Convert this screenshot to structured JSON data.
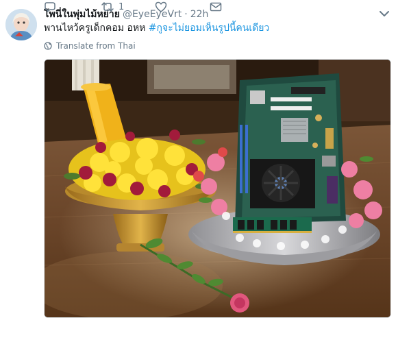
{
  "tweet": {
    "display_name": "โพนี่ในพุ่มไม้หย่าย",
    "handle": "@EyeEyeVrt",
    "separator": "·",
    "timestamp": "22h",
    "text_plain": "พานไหว้ครูเด็กคอม อหห ",
    "text_hashtag": "#กูจะไม่ยอมเห็นรูปนี้คนเดียว",
    "translate_label": "Translate from Thai",
    "retweet_count": "1",
    "media_alt": ""
  },
  "colors": {
    "link": "#1b95e0",
    "secondary_text": "#657786",
    "primary_text": "#14171a"
  },
  "icons": {
    "caret": "chevron-down-icon",
    "translate": "globe-icon",
    "reply": "reply-icon",
    "retweet": "retweet-icon",
    "like": "heart-icon",
    "dm": "envelope-icon"
  }
}
